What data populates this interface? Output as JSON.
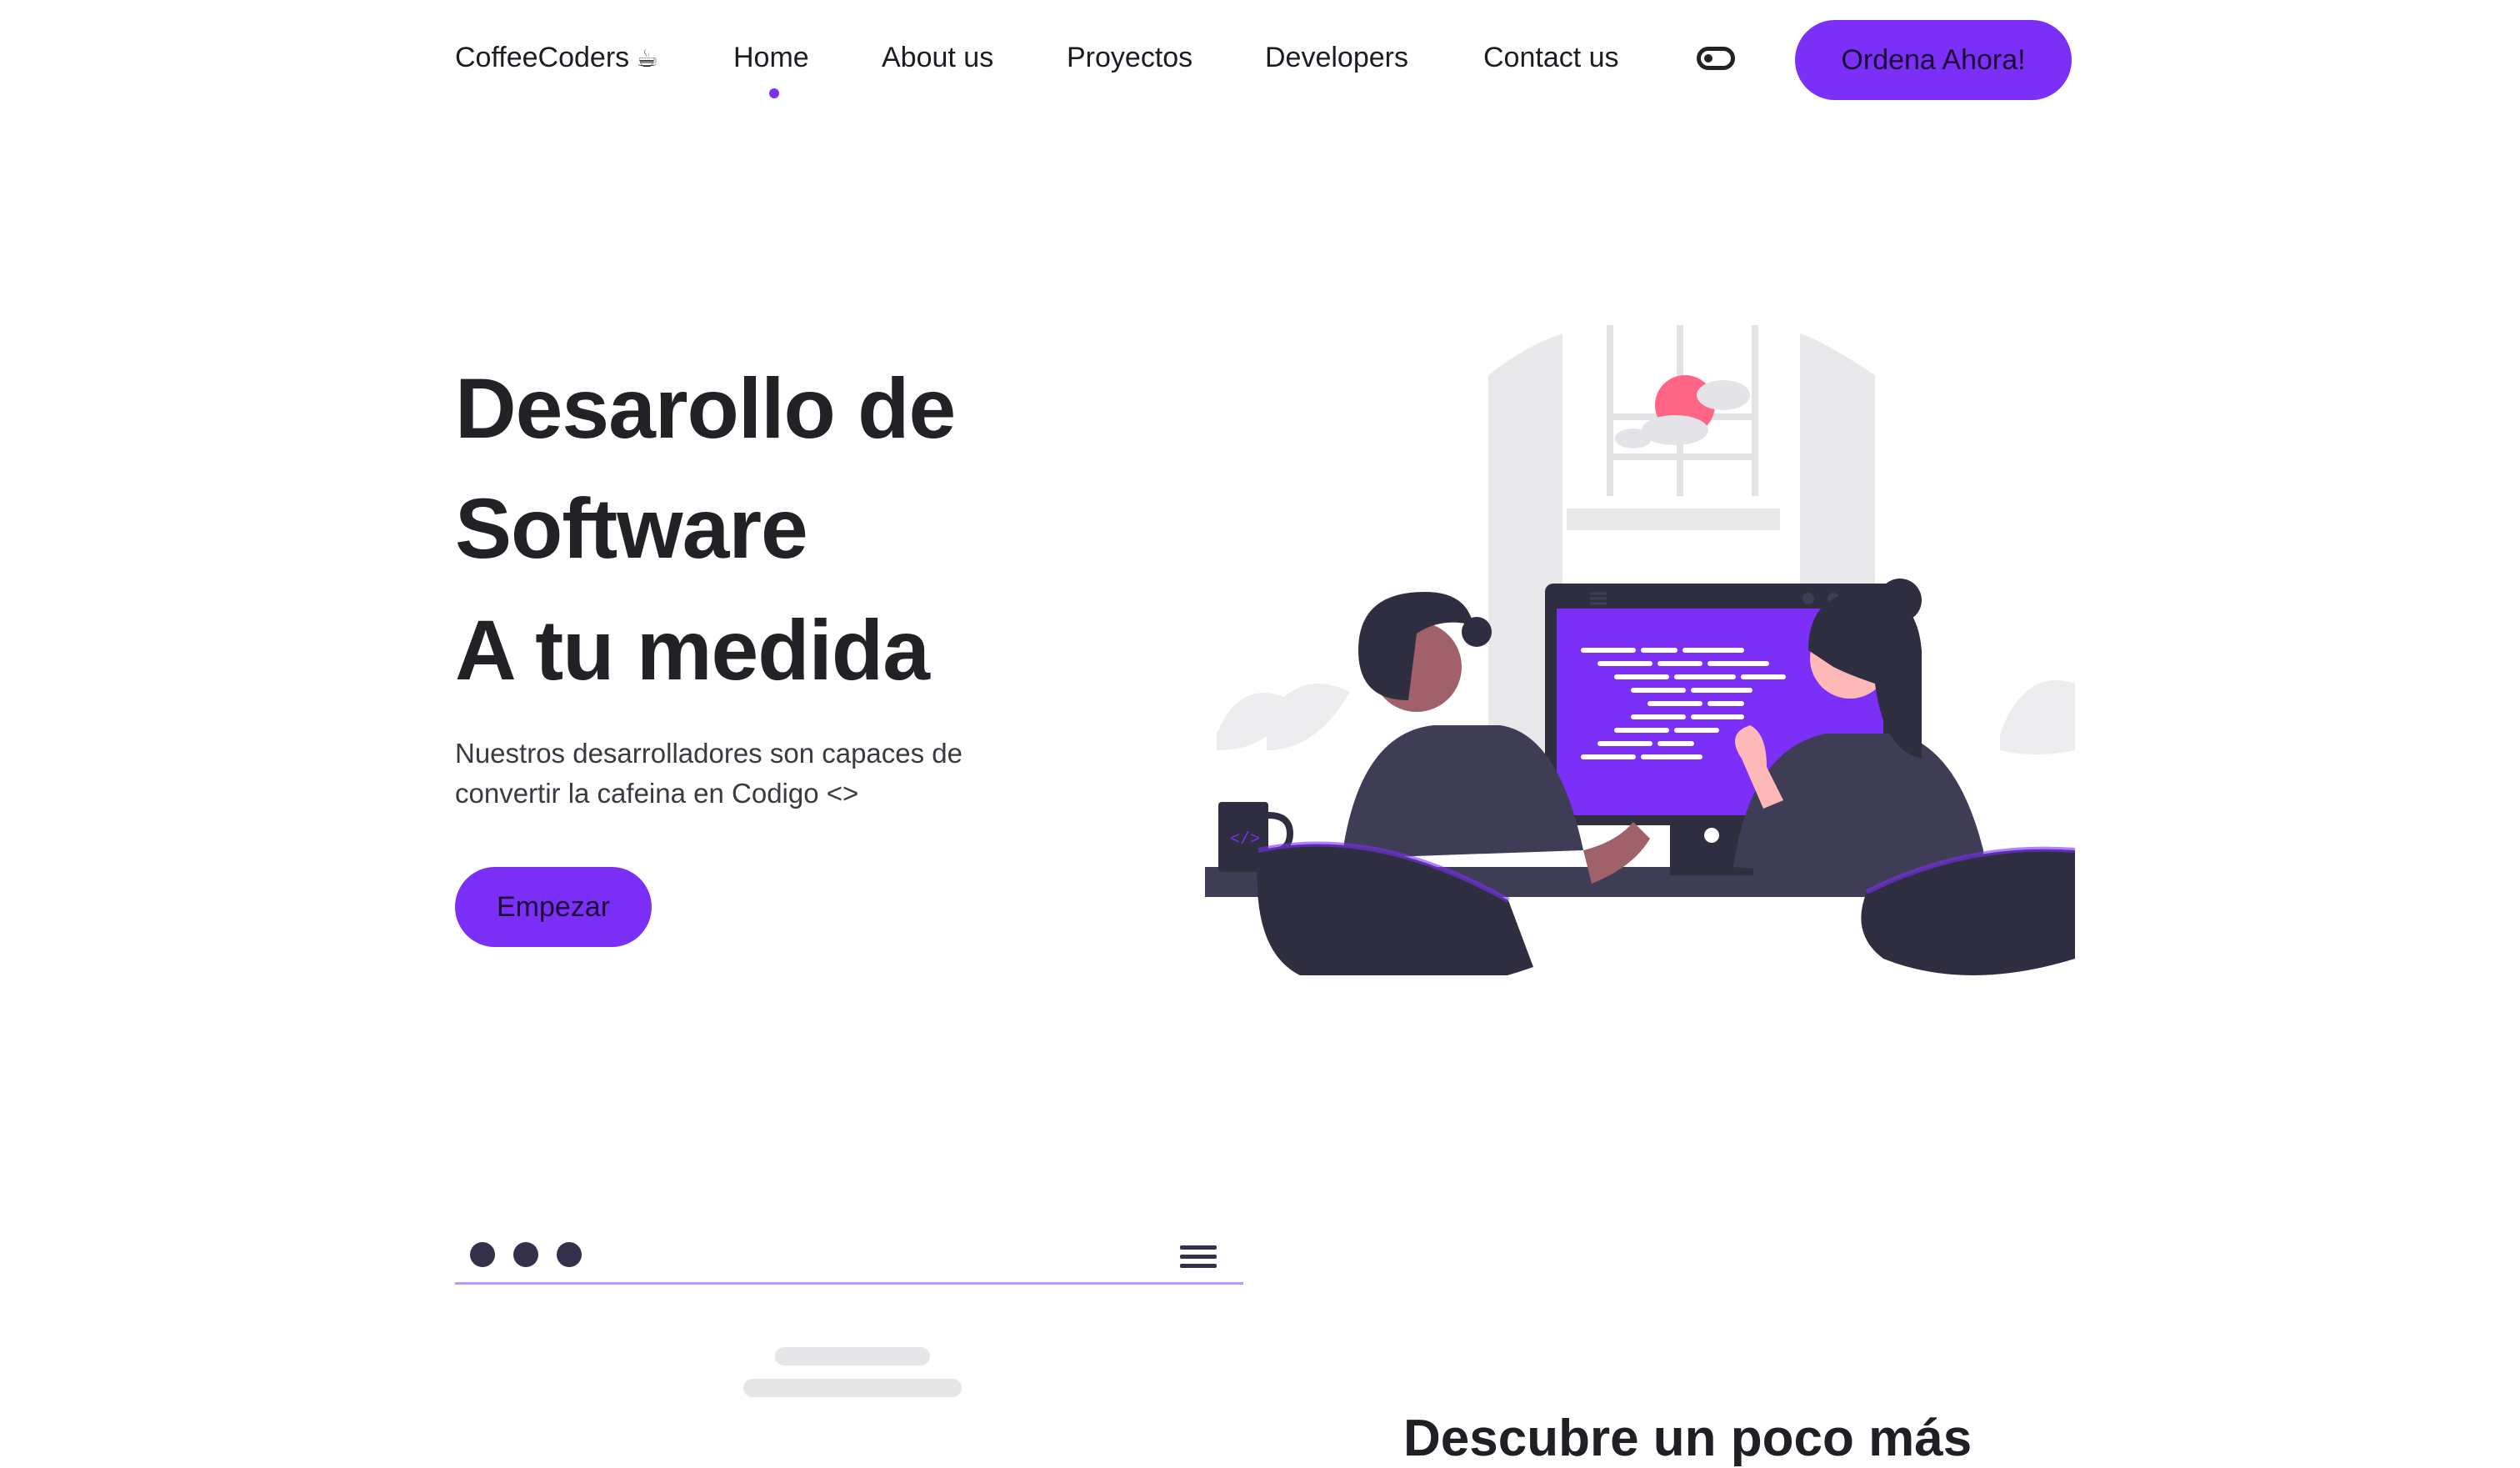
{
  "nav": {
    "brand": "CoffeeCoders",
    "brand_icon": "☕",
    "links": [
      {
        "label": "Home",
        "active": true
      },
      {
        "label": "About us",
        "active": false
      },
      {
        "label": "Proyectos",
        "active": false
      },
      {
        "label": "Developers",
        "active": false
      },
      {
        "label": "Contact us",
        "active": false
      }
    ],
    "theme_toggle_icon": "toggle-icon",
    "cta_label": "Ordena Ahora!"
  },
  "hero": {
    "title_lines": [
      "Desarollo de",
      "Software",
      "A tu medida"
    ],
    "subtitle": "Nuestros desarrolladores son capaces de convertir la cafeina en Codigo <>",
    "button_label": "Empezar",
    "illustration": "developers-at-computer-illustration"
  },
  "section": {
    "title": "Descubre un poco más",
    "window_icons": [
      "dot-icon",
      "dot-icon",
      "dot-icon",
      "hamburger-icon"
    ]
  },
  "colors": {
    "accent": "#7b2ff7",
    "dark": "#2f2e41",
    "text": "#222226",
    "sun": "#ff6584"
  }
}
